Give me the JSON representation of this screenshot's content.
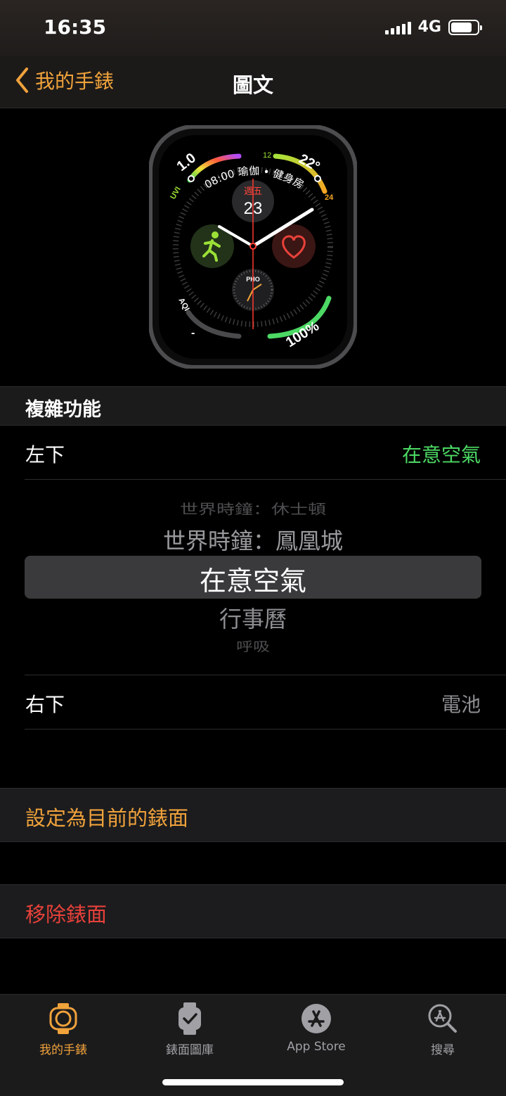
{
  "status": {
    "time": "16:35",
    "network": "4G"
  },
  "nav": {
    "back_label": "我的手錶",
    "title": "圖文"
  },
  "watch_face": {
    "top_left_value": "1.0",
    "top_left_label": "UVI",
    "top_center_text": "08:00 瑜伽 • 健身房",
    "top_right_small": "12",
    "top_right_value": "22°",
    "top_right_end": "24",
    "date_weekday": "週五",
    "date_day": "23",
    "subdial_label": "PHO",
    "bottom_left_label": "AQI",
    "bottom_left_value": "-",
    "bottom_right_value": "100%",
    "colors": {
      "accent": "#f0a23b",
      "activity": "#9be036",
      "heart": "#e8413a",
      "battery": "#4cd964"
    }
  },
  "complications": {
    "section_title": "複雜功能",
    "bottom_left": {
      "label": "左下",
      "value": "在意空氣"
    },
    "picker": {
      "items": [
        "世界時鐘：休士頓",
        "世界時鐘：鳳凰城",
        "在意空氣",
        "行事曆",
        "呼吸"
      ],
      "selected_index": 2
    },
    "bottom_right": {
      "label": "右下",
      "value": "電池"
    }
  },
  "actions": {
    "set_current": "設定為目前的錶面",
    "remove": "移除錶面"
  },
  "tabs": [
    {
      "label": "我的手錶",
      "icon": "watch-icon",
      "active": true
    },
    {
      "label": "錶面圖庫",
      "icon": "face-gallery-icon",
      "active": false
    },
    {
      "label": "App Store",
      "icon": "app-store-icon",
      "active": false
    },
    {
      "label": "搜尋",
      "icon": "search-icon",
      "active": false
    }
  ],
  "colors": {
    "accent": "#f0a23b",
    "green": "#4cd964",
    "red": "#e8413a"
  }
}
